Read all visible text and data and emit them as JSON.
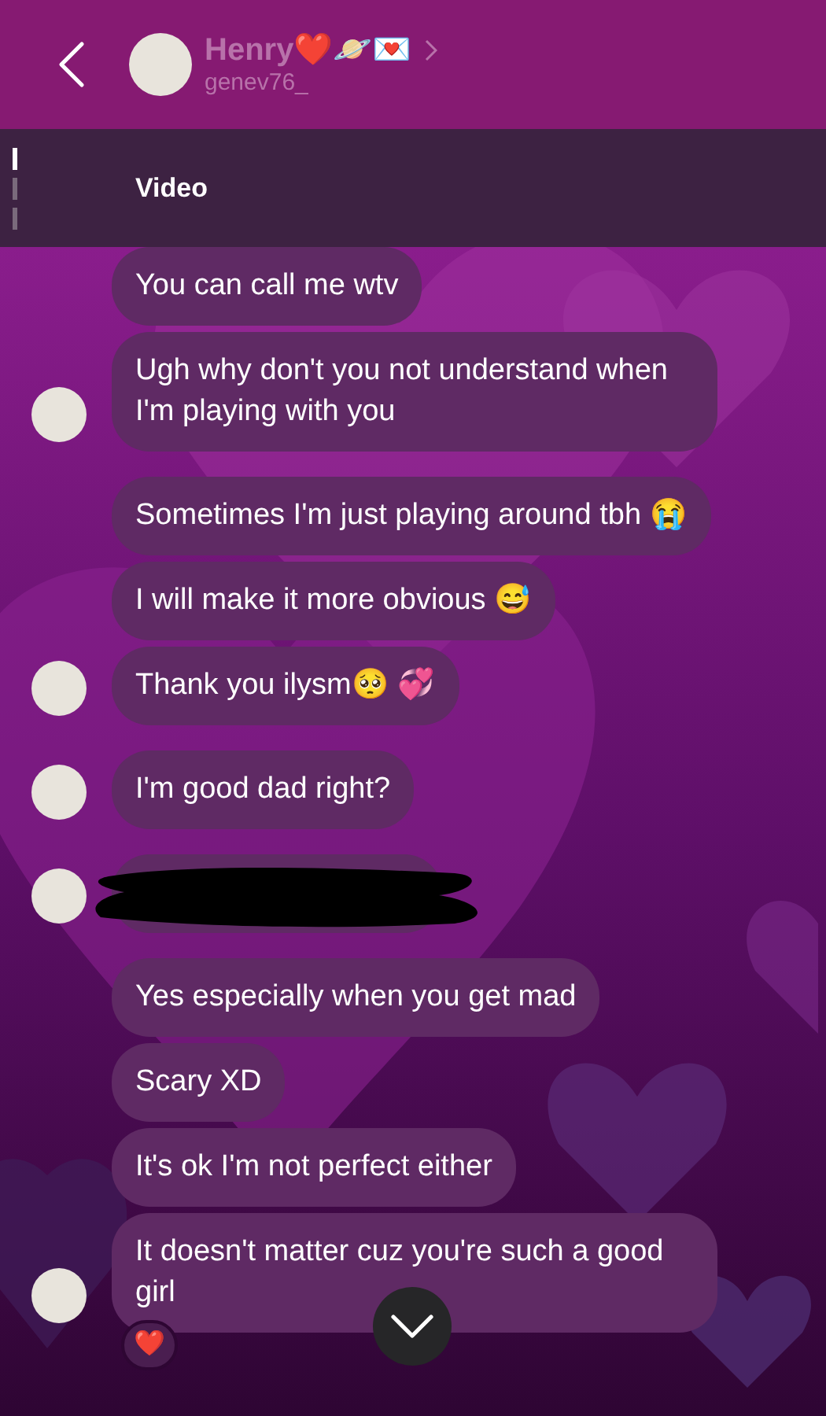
{
  "header": {
    "name": "Henry❤️🪐💌",
    "username": "genev76_"
  },
  "pinned": {
    "label": "Video"
  },
  "messages": [
    {
      "kind": "text",
      "text": "You can call me wtv",
      "avatar": false
    },
    {
      "kind": "text",
      "text": "Ugh why don't you not understand when I'm playing with you",
      "avatar": true
    },
    {
      "kind": "text",
      "text": "Sometimes I'm just playing around tbh 😭",
      "avatar": false
    },
    {
      "kind": "text",
      "text": "I will make it more obvious 😅",
      "avatar": false
    },
    {
      "kind": "text",
      "text": "Thank you ilysm🥺 💞",
      "avatar": true
    },
    {
      "kind": "text",
      "text": "I'm good dad right?",
      "avatar": true
    },
    {
      "kind": "redacted",
      "avatar": true
    },
    {
      "kind": "text",
      "text": "Yes especially when you get mad",
      "avatar": false
    },
    {
      "kind": "text",
      "text": "Scary XD",
      "avatar": false
    },
    {
      "kind": "text",
      "text": "It's ok I'm not perfect either",
      "avatar": false
    },
    {
      "kind": "text",
      "text": "It doesn't matter cuz you're such a good girl",
      "avatar": true,
      "reaction": "❤️"
    }
  ]
}
